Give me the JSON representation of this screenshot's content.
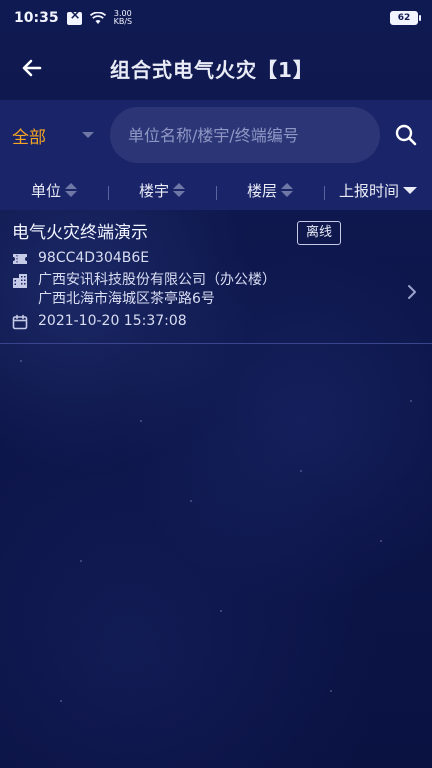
{
  "status_bar": {
    "time": "10:35",
    "net_speed_value": "3.00",
    "net_speed_unit": "KB/S",
    "battery": "62"
  },
  "header": {
    "title": "组合式电气火灾【1】"
  },
  "search": {
    "filter_value": "全部",
    "placeholder": "单位名称/楼宇/终端编号"
  },
  "sort_bar": {
    "items": [
      {
        "label": "单位"
      },
      {
        "label": "楼宇"
      },
      {
        "label": "楼层"
      },
      {
        "label": "上报时间"
      }
    ]
  },
  "list": {
    "items": [
      {
        "title": "电气火灾终端演示",
        "status": "离线",
        "terminal_id": "98CC4D304B6E",
        "unit": "广西安讯科技股份有限公司（办公楼）",
        "address": "广西北海市海城区茶亭路6号",
        "time": "2021-10-20 15:37:08"
      }
    ]
  },
  "colors": {
    "accent": "#f5a524",
    "background": "#0b1446",
    "panel": "#1a2468"
  }
}
